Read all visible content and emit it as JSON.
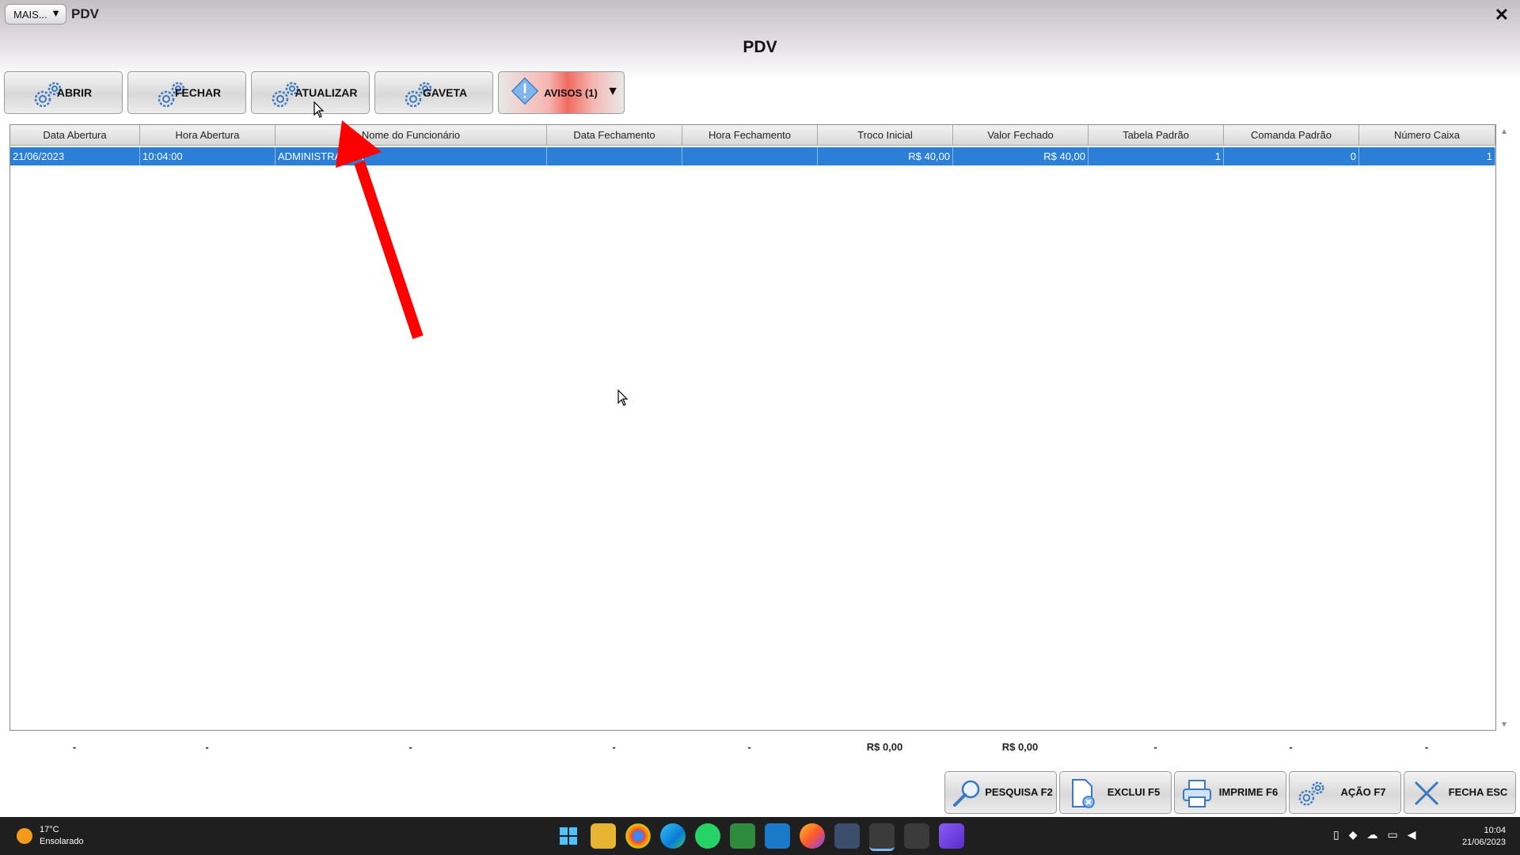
{
  "window": {
    "mais_label": "MAIS...",
    "title": "PDV",
    "close": "✕"
  },
  "page_title": "PDV",
  "toolbar": {
    "abrir": "ABRIR",
    "fechar": "FECHAR",
    "atualizar": "ATUALIZAR",
    "gaveta": "GAVETA",
    "avisos": "AVISOS (1)"
  },
  "table": {
    "columns": [
      "Data Abertura",
      "Hora Abertura",
      "Nome do Funcionário",
      "Data Fechamento",
      "Hora Fechamento",
      "Troco Inicial",
      "Valor Fechado",
      "Tabela Padrão",
      "Comanda Padrão",
      "Número Caixa"
    ],
    "rows": [
      [
        "21/06/2023",
        "10:04:00",
        "ADMINISTRADOR",
        "",
        "",
        "R$ 40,00",
        "R$ 40,00",
        "1",
        "0",
        "1"
      ]
    ]
  },
  "footer_totals": [
    "-",
    "-",
    "-",
    "-",
    "-",
    "R$ 0,00",
    "R$ 0,00",
    "-",
    "-",
    "-"
  ],
  "bottom_buttons": {
    "pesquisa": "PESQUISA F2",
    "exclui": "EXCLUI F5",
    "imprime": "IMPRIME F6",
    "acao": "AÇÃO F7",
    "fecha": "FECHA ESC"
  },
  "taskbar": {
    "weather_temp": "17°C",
    "weather_desc": "Ensolarado",
    "time": "10:04",
    "date": "21/06/2023"
  },
  "colors": {
    "selection": "#2b7fd6",
    "annotation_arrow": "#ff0000"
  }
}
